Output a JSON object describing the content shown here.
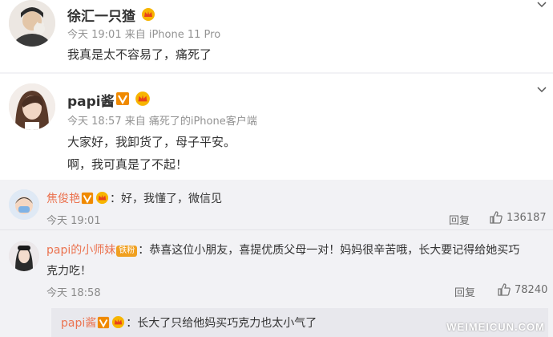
{
  "colors": {
    "accent_name": "#eb7350",
    "meta_gray": "#939393",
    "comment_bg": "#f2f2f5",
    "vip_orange": "#f08a00"
  },
  "posts": [
    {
      "name": "徐汇一只猹",
      "meta": "今天 19:01 来自 iPhone 11 Pro",
      "lines": [
        "我真是太不容易了，痛死了"
      ]
    },
    {
      "name": "papi酱",
      "meta": "今天 18:57 来自 痛死了的iPhone客户端",
      "lines": [
        "大家好，我卸货了，母子平安。",
        "啊，我可真是了不起！"
      ]
    }
  ],
  "comments": [
    {
      "name": "焦俊艳",
      "text": "：好，我懂了，微信见",
      "time": "今天 19:01",
      "reply": "回复",
      "likes": "136187"
    },
    {
      "name": "papi的小师妹",
      "fan_badge": "铁粉",
      "text": "：恭喜这位小朋友，喜提优质父母一对！妈妈很辛苦哦，长大要记得给她买巧",
      "text2": "克力吃！",
      "time": "今天 18:58",
      "reply": "回复",
      "likes": "78240"
    }
  ],
  "sub_reply": {
    "name": "papi酱",
    "text": "：长大了只给他妈买巧克力也太小气了"
  },
  "watermark": "WEIMEICUN.COM"
}
